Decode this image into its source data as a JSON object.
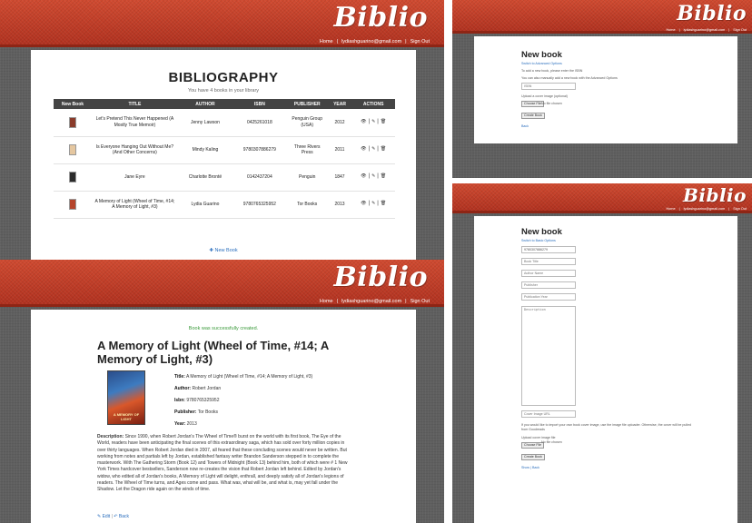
{
  "brand": {
    "logo_text": "Biblio",
    "header_color": "#c63a24",
    "link_color": "#2a6ebd",
    "success_color": "#3a9a3a"
  },
  "user_nav": {
    "home": "Home",
    "email": "lydiashguarino@gmail.com",
    "sign_out": "Sign Out",
    "separator": "|"
  },
  "bibliography": {
    "title": "BIBLIOGRAPHY",
    "subtitle": "You have 4 books in your library",
    "columns": [
      "New Book",
      "TITLE",
      "AUTHOR",
      "ISBN",
      "PUBLISHER",
      "YEAR",
      "ACTIONS"
    ],
    "rows": [
      {
        "title": "Let's Pretend This Never Happened (A Mostly True Memoir)",
        "author": "Jenny Lawson",
        "isbn": "0425261018",
        "publisher": "Penguin Group (USA)",
        "year": "2012",
        "cover_color": "#8a3b2a"
      },
      {
        "title": "Is Everyone Hanging Out Without Me? (And Other Concerns)",
        "author": "Mindy Kaling",
        "isbn": "9780307886279",
        "publisher": "Three Rivers Press",
        "year": "2011",
        "cover_color": "#e5c7a0"
      },
      {
        "title": "Jane Eyre",
        "author": "Charlotte Brontë",
        "isbn": "0142437204",
        "publisher": "Penguin",
        "year": "1847",
        "cover_color": "#2b2b2b"
      },
      {
        "title": "A Memory of Light (Wheel of Time, #14; A Memory of Light, #3)",
        "author": "Lydia Guarino",
        "isbn": "9780765325952",
        "publisher": "Tor Books",
        "year": "2013",
        "cover_color": "#b5442b"
      }
    ],
    "action_icons": [
      "eye-icon",
      "pencil-icon",
      "trash-icon"
    ],
    "new_book_link": "✚ New Book"
  },
  "detail": {
    "flash": "Book was successfully created.",
    "heading": "A Memory of Light (Wheel of Time, #14; A Memory of Light, #3)",
    "cover_text": "A MEMORY OF LIGHT",
    "title_label": "Title:",
    "title_value": "A Memory of Light (Wheel of Time, #14; A Memory of Light, #3)",
    "author_label": "Author:",
    "author_value": "Robert Jordan",
    "isbn_label": "Isbn:",
    "isbn_value": "9780765325952",
    "publisher_label": "Publisher:",
    "publisher_value": "Tor Books",
    "year_label": "Year:",
    "year_value": "2013",
    "description_label": "Description:",
    "description_value": "Since 1990, when Robert Jordan's The Wheel of Time® burst on the world with its first book, The Eye of the World, readers have been anticipating the final scenes of this extraordinary saga, which has sold over forty million copies in over thirty languages. When Robert Jordan died in 2007, all feared that these concluding scenes would never be written. But working from notes and partials left by Jordan, established fantasy writer Brandon Sanderson stepped in to complete the masterwork. With The Gathering Storm (Book 12) and Towers of Midnight (Book 13) behind him, both of which were # 1 New York Times hardcover bestsellers, Sanderson now re-creates the vision that Robert Jordan left behind. Edited by Jordan's widow, who edited all of Jordan's books, A Memory of Light will delight, enthrall, and deeply satisfy all of Jordan's legions of readers. The Wheel of Time turns, and Ages come and pass. What was, what will be, and what is, may yet fall under the Shadow. Let the Dragon ride again on the winds of time.",
    "edit_link": "✎ Edit",
    "back_link": "↶ Back"
  },
  "new_book_simple": {
    "heading": "New book",
    "advanced_link": "Switch to Advanced Options",
    "instruction1": "To add a new book, please enter the ISBN",
    "instruction2": "You can also manually add a new book with the Advanced Options",
    "isbn_placeholder": "ISBN",
    "upload_label": "Upload a cover image (optional)",
    "choose_file": "Choose File",
    "no_file": "No file chosen",
    "create_button": "Create Book",
    "back_link": "Back"
  },
  "new_book_advanced": {
    "heading": "New book",
    "basic_link": "Switch to Basic Options",
    "isbn_value": "9780307886279",
    "fields": [
      "Book Title",
      "Author Name",
      "Publisher",
      "Publication Year"
    ],
    "description_placeholder": "Description",
    "cover_url_placeholder": "Cover Image URL",
    "help_text": "If you would like to import your own book cover image, use the image file uploader. Otherwise, the cover will be pulled from Goodreads",
    "upload_label": "Upload cover image file",
    "choose_file": "Choose File",
    "no_file": "No file chosen",
    "create_button": "Create Book",
    "show_link": "Show",
    "back_link": "Back"
  }
}
